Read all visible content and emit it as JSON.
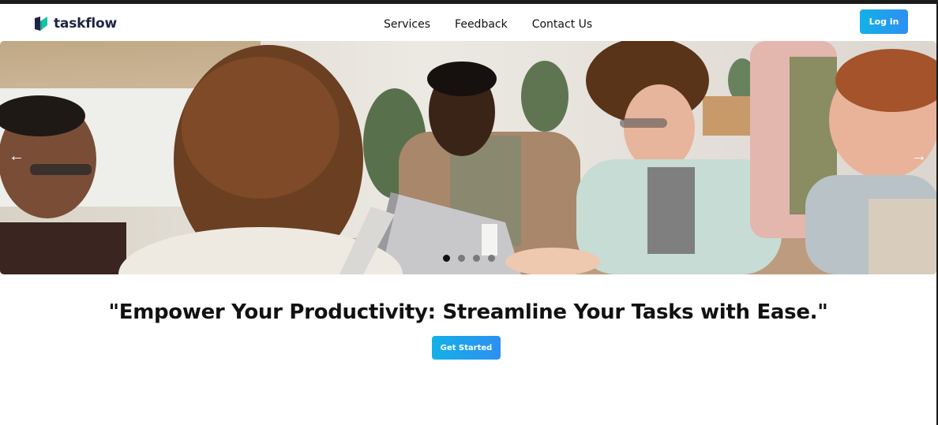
{
  "brand": {
    "name": "taskflow",
    "logo_icon": "taskflow-logo-icon",
    "logo_colors": [
      "#1f2447",
      "#17c3a6"
    ]
  },
  "nav": {
    "links": [
      {
        "label": "Services"
      },
      {
        "label": "Feedback"
      },
      {
        "label": "Contact Us"
      }
    ],
    "login_label": "Log in"
  },
  "carousel": {
    "image_icon": "team-meeting-photo",
    "prev_icon": "arrow-left-icon",
    "prev_glyph": "←",
    "next_icon": "arrow-right-icon",
    "next_glyph": "→",
    "slide_count": 4,
    "active_slide": 1
  },
  "hero": {
    "headline": "\"Empower Your Productivity: Streamline Your Tasks with Ease.\"",
    "cta_label": "Get Started"
  },
  "colors": {
    "accent_start": "#13b1e6",
    "accent_end": "#2e8ff2",
    "text": "#111111"
  }
}
